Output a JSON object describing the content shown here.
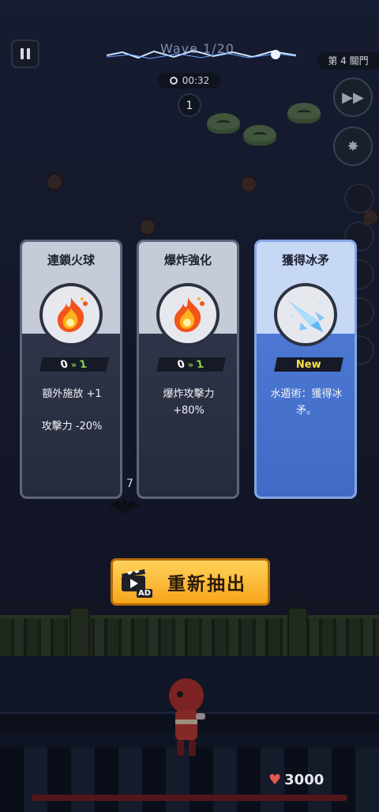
{
  "hud": {
    "wave_text": "Wave 1/20",
    "timer": "00:32",
    "count": "1",
    "stage": "第 4 關門"
  },
  "scene": {
    "combo": "7"
  },
  "cards": [
    {
      "title": "連鎖火球",
      "icon": "fireball-icon",
      "level_from": "0",
      "level_to": "1",
      "desc_lines": [
        "額外施放 +1",
        "攻擊力 -20%"
      ]
    },
    {
      "title": "爆炸強化",
      "icon": "fireball-icon",
      "level_from": "0",
      "level_to": "1",
      "desc_lines": [
        "爆炸攻擊力 +80%"
      ]
    },
    {
      "title": "獲得冰矛",
      "icon": "ice-spear-icon",
      "badge": "New",
      "desc_lines": [
        "水遁術：獲得冰矛。"
      ]
    }
  ],
  "reroll": {
    "label": "重新抽出",
    "ad_label": "AD"
  },
  "player": {
    "hp": "3000"
  },
  "colors": {
    "card_gray": "#2f3548",
    "card_blue": "#4c78d4",
    "level_green": "#8ad34a",
    "new_yellow": "#ffe14a",
    "button_orange": "#f7a51b"
  }
}
